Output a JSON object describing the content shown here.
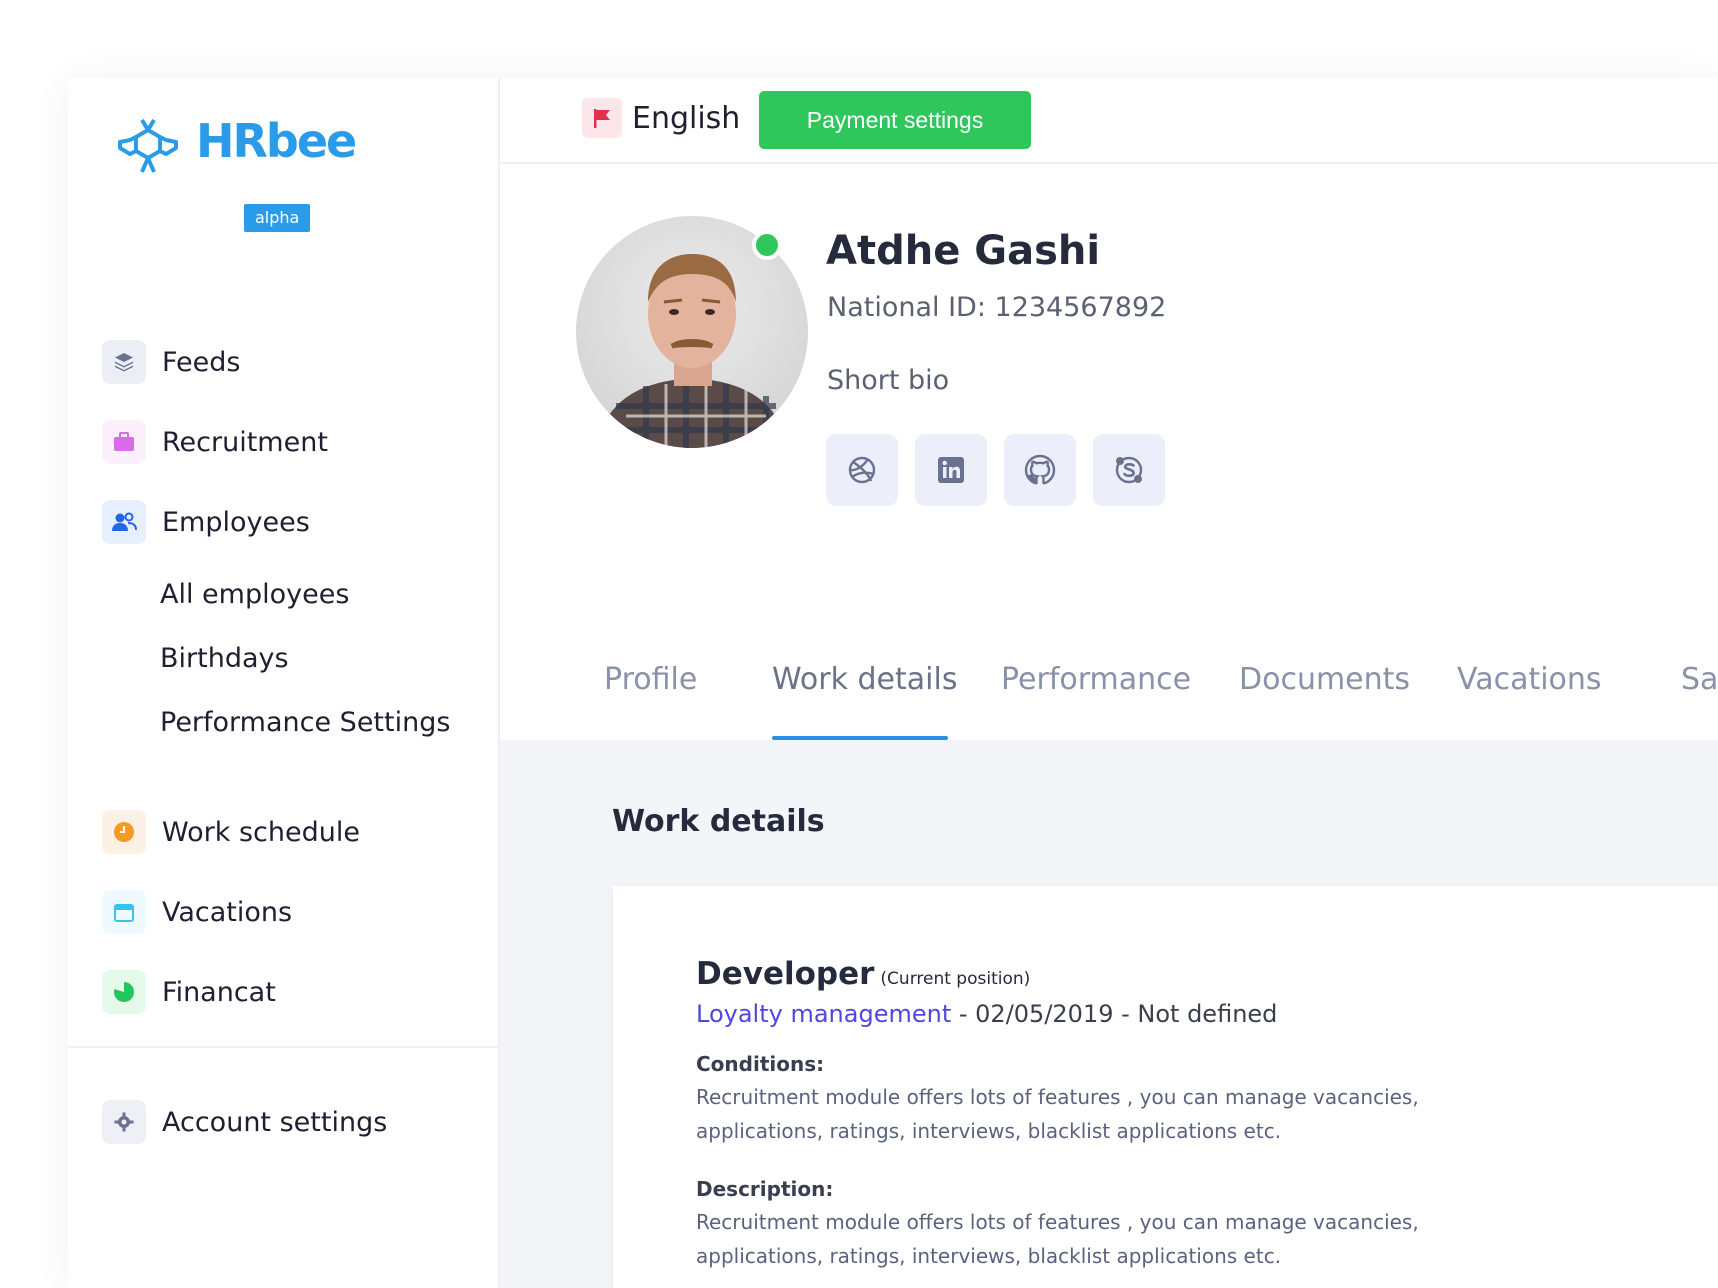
{
  "brand": {
    "name": "HRbee",
    "badge": "alpha"
  },
  "sidebar": {
    "items": [
      {
        "label": "Feeds",
        "icon": "layers-icon"
      },
      {
        "label": "Recruitment",
        "icon": "briefcase-icon"
      },
      {
        "label": "Employees",
        "icon": "users-icon"
      }
    ],
    "sub_items": [
      {
        "label": "All employees"
      },
      {
        "label": "Birthdays"
      },
      {
        "label": "Performance Settings"
      }
    ],
    "items2": [
      {
        "label": "Work schedule",
        "icon": "clock-icon"
      },
      {
        "label": "Vacations",
        "icon": "calendar-icon"
      },
      {
        "label": "Financat",
        "icon": "pie-chart-icon"
      }
    ],
    "account_label": "Account settings"
  },
  "topbar": {
    "language": "English",
    "payment_button": "Payment settings"
  },
  "profile": {
    "name": "Atdhe Gashi",
    "national_id": "National ID: 1234567892",
    "bio": "Short bio",
    "status": "online",
    "socials": [
      "dribbble-icon",
      "linkedin-icon",
      "github-icon",
      "skype-icon"
    ]
  },
  "tabs": [
    {
      "label": "Profile",
      "active": false
    },
    {
      "label": "Work details",
      "active": true
    },
    {
      "label": "Performance",
      "active": false
    },
    {
      "label": "Documents",
      "active": false
    },
    {
      "label": "Vacations",
      "active": false
    },
    {
      "label": "Sa",
      "active": false
    }
  ],
  "work_details": {
    "section_title": "Work details",
    "role": "Developer",
    "current_label": "(Current position)",
    "department": "Loyalty management",
    "period": " - 02/05/2019 - Not defined",
    "conditions_label": "Conditions:",
    "conditions_text": "Recruitment module offers lots of features , you can manage vacancies, applications, ratings, interviews, blacklist applications etc.",
    "description_label": "Description:",
    "description_text": "Recruitment module offers lots of features , you can manage vacancies, applications, ratings, interviews, blacklist applications etc."
  },
  "colors": {
    "brand_blue": "#2a9be8",
    "success_green": "#2fc75c",
    "link_purple": "#5146e0",
    "tab_underline": "#2a8de8"
  }
}
